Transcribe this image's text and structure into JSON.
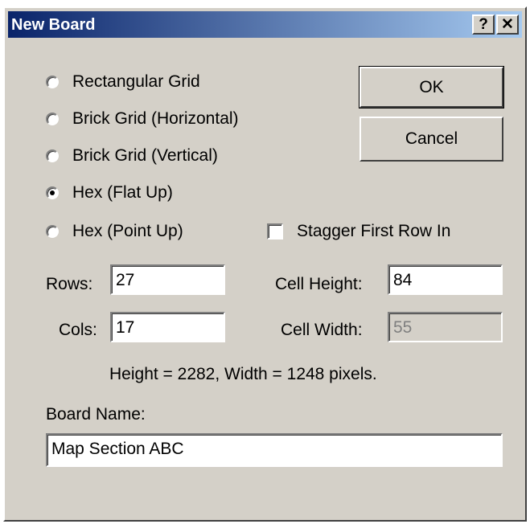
{
  "dialog": {
    "title": "New Board",
    "help_button": "?",
    "close_button": "✕"
  },
  "grid_types": [
    {
      "label": "Rectangular Grid",
      "selected": false
    },
    {
      "label": "Brick Grid (Horizontal)",
      "selected": false
    },
    {
      "label": "Brick Grid (Vertical)",
      "selected": false
    },
    {
      "label": "Hex (Flat Up)",
      "selected": true
    },
    {
      "label": "Hex (Point Up)",
      "selected": false
    }
  ],
  "buttons": {
    "ok": "OK",
    "cancel": "Cancel"
  },
  "stagger": {
    "label": "Stagger First Row In",
    "checked": false
  },
  "fields": {
    "rows_label": "Rows:",
    "rows_value": "27",
    "cols_label": "Cols:",
    "cols_value": "17",
    "cell_height_label": "Cell Height:",
    "cell_height_value": "84",
    "cell_width_label": "Cell Width:",
    "cell_width_value": "55"
  },
  "size_summary": "Height = 2282, Width = 1248 pixels.",
  "board_name": {
    "label": "Board Name:",
    "value": "Map Section ABC"
  }
}
